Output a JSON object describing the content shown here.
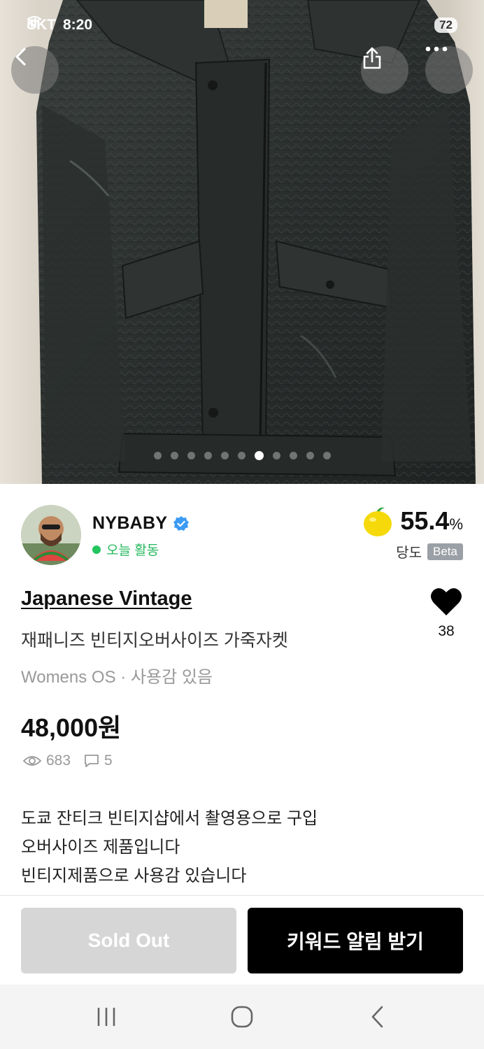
{
  "status_bar": {
    "carrier": "SKT",
    "time": "8:20",
    "battery": "72"
  },
  "hero": {
    "image_label": "leather-jacket-photo",
    "total_images": 11,
    "active_index": 6
  },
  "seller": {
    "name": "NYBABY",
    "activity": "오늘 활동",
    "score": "55.4",
    "score_unit": "%",
    "score_label": "당도",
    "beta_label": "Beta"
  },
  "product": {
    "brand": "Japanese Vintage",
    "title": "재패니즈 빈티지오버사이즈 가죽자켓",
    "meta": "Womens OS · 사용감 있음",
    "price": "48,000원",
    "views": "683",
    "chats": "5",
    "likes": "38",
    "description": [
      "도쿄 잔티크 빈티지샵에서 촬영용으로 구입",
      "오버사이즈 제품입니다",
      "빈티지제품으로 사용감 있습니다"
    ]
  },
  "actions": {
    "sold_out_label": "Sold Out",
    "keyword_alert_label": "키워드 알림 받기"
  },
  "colors": {
    "active_green": "#22c55e",
    "verified_blue": "#3b9bf5",
    "primary_button": "#000000",
    "disabled_button": "#d6d6d6"
  }
}
